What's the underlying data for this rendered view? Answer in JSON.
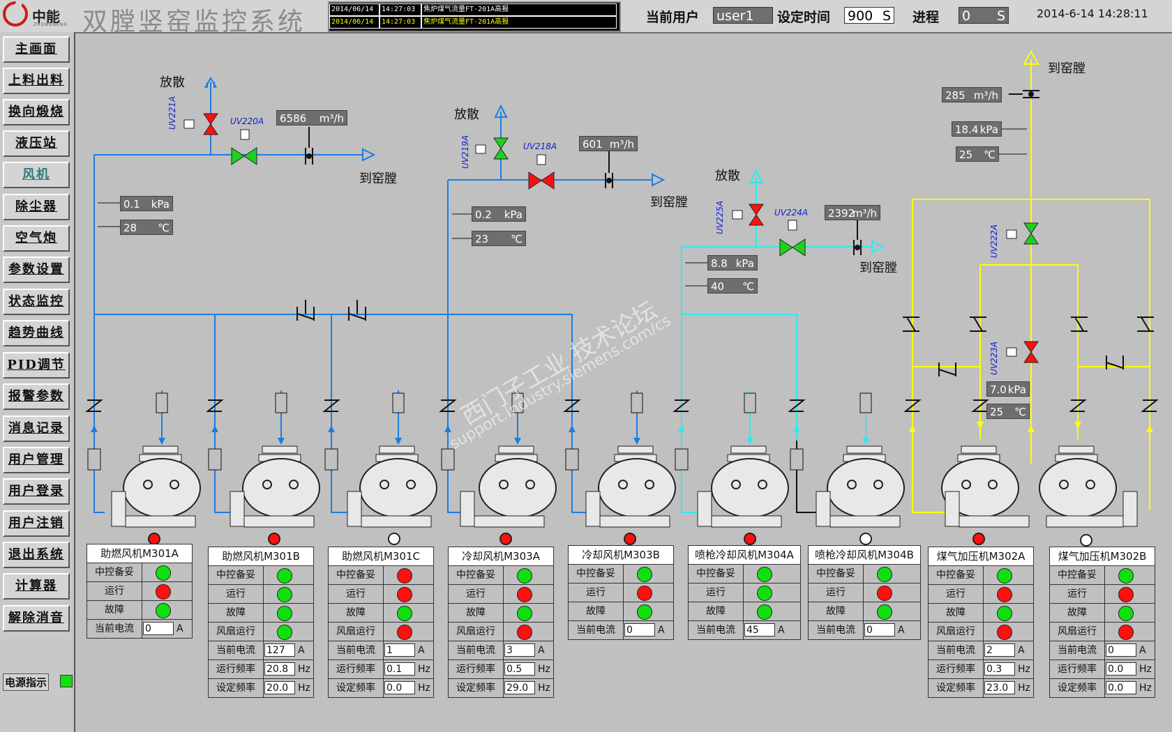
{
  "header": {
    "logo_text": "中能",
    "logo_sub": "ZHONGNENG",
    "title": "双膛竖窑监控系统",
    "alarms": [
      {
        "date": "2014/06/14",
        "time": "14:27:03",
        "msg": "焦炉煤气流量FT-201A高报",
        "color": "#ffffff"
      },
      {
        "date": "2014/06/14",
        "time": "14:27:03",
        "msg": "焦炉煤气流量FT-201A高报",
        "color": "#ffff00"
      }
    ],
    "user_label": "当前用户",
    "user_value": "user1",
    "set_time_label": "设定时间",
    "set_time_value": "900",
    "set_time_unit": "S",
    "process_label": "进程",
    "process_value": "0",
    "process_unit": "S",
    "clock": "2014-6-14 14:28:11"
  },
  "nav": {
    "items": [
      {
        "label": "主画面",
        "active": false
      },
      {
        "label": "上料出料",
        "active": false
      },
      {
        "label": "换向煅烧",
        "active": false
      },
      {
        "label": "液压站",
        "active": false
      },
      {
        "label": "风机",
        "active": true
      },
      {
        "label": "除尘器",
        "active": false
      },
      {
        "label": "空气炮",
        "active": false
      },
      {
        "label": "参数设置",
        "active": false
      },
      {
        "label": "状态监控",
        "active": false
      },
      {
        "label": "趋势曲线",
        "active": false
      },
      {
        "label": "PID调节",
        "active": false
      },
      {
        "label": "报警参数",
        "active": false
      },
      {
        "label": "消息记录",
        "active": false
      },
      {
        "label": "用户管理",
        "active": false
      },
      {
        "label": "用户登录",
        "active": false
      },
      {
        "label": "用户注销",
        "active": false
      },
      {
        "label": "退出系统",
        "active": false
      },
      {
        "label": "计算器",
        "active": false
      },
      {
        "label": "解除消音",
        "active": false
      }
    ],
    "power_label": "电源指示"
  },
  "colors": {
    "blue_line": "#1a7de0",
    "cyan_line": "#30e8f0",
    "yellow_line": "#ffff00",
    "led_green": "#10e010",
    "led_red": "#ff1010",
    "valve_green": "#20d020",
    "valve_red": "#ff1010"
  },
  "labels": {
    "vent": "放散",
    "to_kiln": "到窑膛"
  },
  "valves": {
    "uv221a": "UV221A",
    "uv220a": "UV220A",
    "uv219a": "UV219A",
    "uv218a": "UV218A",
    "uv225a": "UV225A",
    "uv224a": "UV224A",
    "uv222a": "UV222A",
    "uv223a": "UV223A"
  },
  "measurements": {
    "flow1": {
      "value": "6586",
      "unit": "m³/h"
    },
    "p1": {
      "value": "0.1",
      "unit": "kPa"
    },
    "t1": {
      "value": "28",
      "unit": "℃"
    },
    "flow2": {
      "value": "601",
      "unit": "m³/h"
    },
    "p2": {
      "value": "0.2",
      "unit": "kPa"
    },
    "t2": {
      "value": "23",
      "unit": "℃"
    },
    "flow3": {
      "value": "2392",
      "unit": "m³/h"
    },
    "p3": {
      "value": "8.8",
      "unit": "kPa"
    },
    "t3": {
      "value": "40",
      "unit": "℃"
    },
    "flow4": {
      "value": "285",
      "unit": "m³/h"
    },
    "p4": {
      "value": "18.4",
      "unit": "kPa"
    },
    "t4": {
      "value": "25",
      "unit": "℃"
    },
    "p5": {
      "value": "7.0",
      "unit": "kPa"
    },
    "t5": {
      "value": "25",
      "unit": "℃"
    }
  },
  "watermark": {
    "line1": "西门子工业  技术论坛",
    "line2": "support.industry.siemens.com/cs"
  },
  "fans": [
    {
      "title": "助燃风机M301A",
      "motor_led": "#ff1010",
      "rows": [
        {
          "label": "中控备妥",
          "led": "#10e010"
        },
        {
          "label": "运行",
          "led": "#ff1010"
        },
        {
          "label": "故障",
          "led": "#10e010"
        },
        {
          "label": "当前电流",
          "value": "0",
          "unit": "A"
        }
      ]
    },
    {
      "title": "助燃风机M301B",
      "motor_led": "#ff1010",
      "rows": [
        {
          "label": "中控备妥",
          "led": "#10e010"
        },
        {
          "label": "运行",
          "led": "#10e010"
        },
        {
          "label": "故障",
          "led": "#10e010"
        },
        {
          "label": "风扇运行",
          "led": "#10e010"
        },
        {
          "label": "当前电流",
          "value": "127",
          "unit": "A"
        },
        {
          "label": "运行频率",
          "value": "20.8",
          "unit": "Hz"
        },
        {
          "label": "设定频率",
          "value": "20.0",
          "unit": "Hz"
        }
      ]
    },
    {
      "title": "助燃风机M301C",
      "motor_led": "#ffffff",
      "rows": [
        {
          "label": "中控备妥",
          "led": "#ff1010"
        },
        {
          "label": "运行",
          "led": "#ff1010"
        },
        {
          "label": "故障",
          "led": "#10e010"
        },
        {
          "label": "风扇运行",
          "led": "#ff1010"
        },
        {
          "label": "当前电流",
          "value": "1",
          "unit": "A"
        },
        {
          "label": "运行频率",
          "value": "0.1",
          "unit": "Hz"
        },
        {
          "label": "设定频率",
          "value": "0.0",
          "unit": "Hz"
        }
      ]
    },
    {
      "title": "冷却风机M303A",
      "motor_led": "#ff1010",
      "rows": [
        {
          "label": "中控备妥",
          "led": "#10e010"
        },
        {
          "label": "运行",
          "led": "#ff1010"
        },
        {
          "label": "故障",
          "led": "#10e010"
        },
        {
          "label": "风扇运行",
          "led": "#ff1010"
        },
        {
          "label": "当前电流",
          "value": "3",
          "unit": "A"
        },
        {
          "label": "运行频率",
          "value": "0.5",
          "unit": "Hz"
        },
        {
          "label": "设定频率",
          "value": "29.0",
          "unit": "Hz"
        }
      ]
    },
    {
      "title": "冷却风机M303B",
      "motor_led": "#ff1010",
      "rows": [
        {
          "label": "中控备妥",
          "led": "#10e010"
        },
        {
          "label": "运行",
          "led": "#ff1010"
        },
        {
          "label": "故障",
          "led": "#10e010"
        },
        {
          "label": "当前电流",
          "value": "0",
          "unit": "A"
        }
      ]
    },
    {
      "title": "喷枪冷却风机M304A",
      "motor_led": "#ff1010",
      "rows": [
        {
          "label": "中控备妥",
          "led": "#10e010"
        },
        {
          "label": "运行",
          "led": "#10e010"
        },
        {
          "label": "故障",
          "led": "#10e010"
        },
        {
          "label": "当前电流",
          "value": "45",
          "unit": "A"
        }
      ]
    },
    {
      "title": "喷枪冷却风机M304B",
      "motor_led": "#ffffff",
      "rows": [
        {
          "label": "中控备妥",
          "led": "#10e010"
        },
        {
          "label": "运行",
          "led": "#ff1010"
        },
        {
          "label": "故障",
          "led": "#10e010"
        },
        {
          "label": "当前电流",
          "value": "0",
          "unit": "A"
        }
      ]
    },
    {
      "title": "煤气加压机M302A",
      "motor_led": "#ff1010",
      "rows": [
        {
          "label": "中控备妥",
          "led": "#10e010"
        },
        {
          "label": "运行",
          "led": "#ff1010"
        },
        {
          "label": "故障",
          "led": "#10e010"
        },
        {
          "label": "风扇运行",
          "led": "#ff1010"
        },
        {
          "label": "当前电流",
          "value": "2",
          "unit": "A"
        },
        {
          "label": "运行频率",
          "value": "0.3",
          "unit": "Hz"
        },
        {
          "label": "设定频率",
          "value": "23.0",
          "unit": "Hz"
        }
      ]
    },
    {
      "title": "煤气加压机M302B",
      "motor_led": "#ffffff",
      "rows": [
        {
          "label": "中控备妥",
          "led": "#10e010"
        },
        {
          "label": "运行",
          "led": "#ff1010"
        },
        {
          "label": "故障",
          "led": "#10e010"
        },
        {
          "label": "风扇运行",
          "led": "#ff1010"
        },
        {
          "label": "当前电流",
          "value": "0",
          "unit": "A"
        },
        {
          "label": "运行频率",
          "value": "0.0",
          "unit": "Hz"
        },
        {
          "label": "设定频率",
          "value": "0.0",
          "unit": "Hz"
        }
      ]
    }
  ]
}
